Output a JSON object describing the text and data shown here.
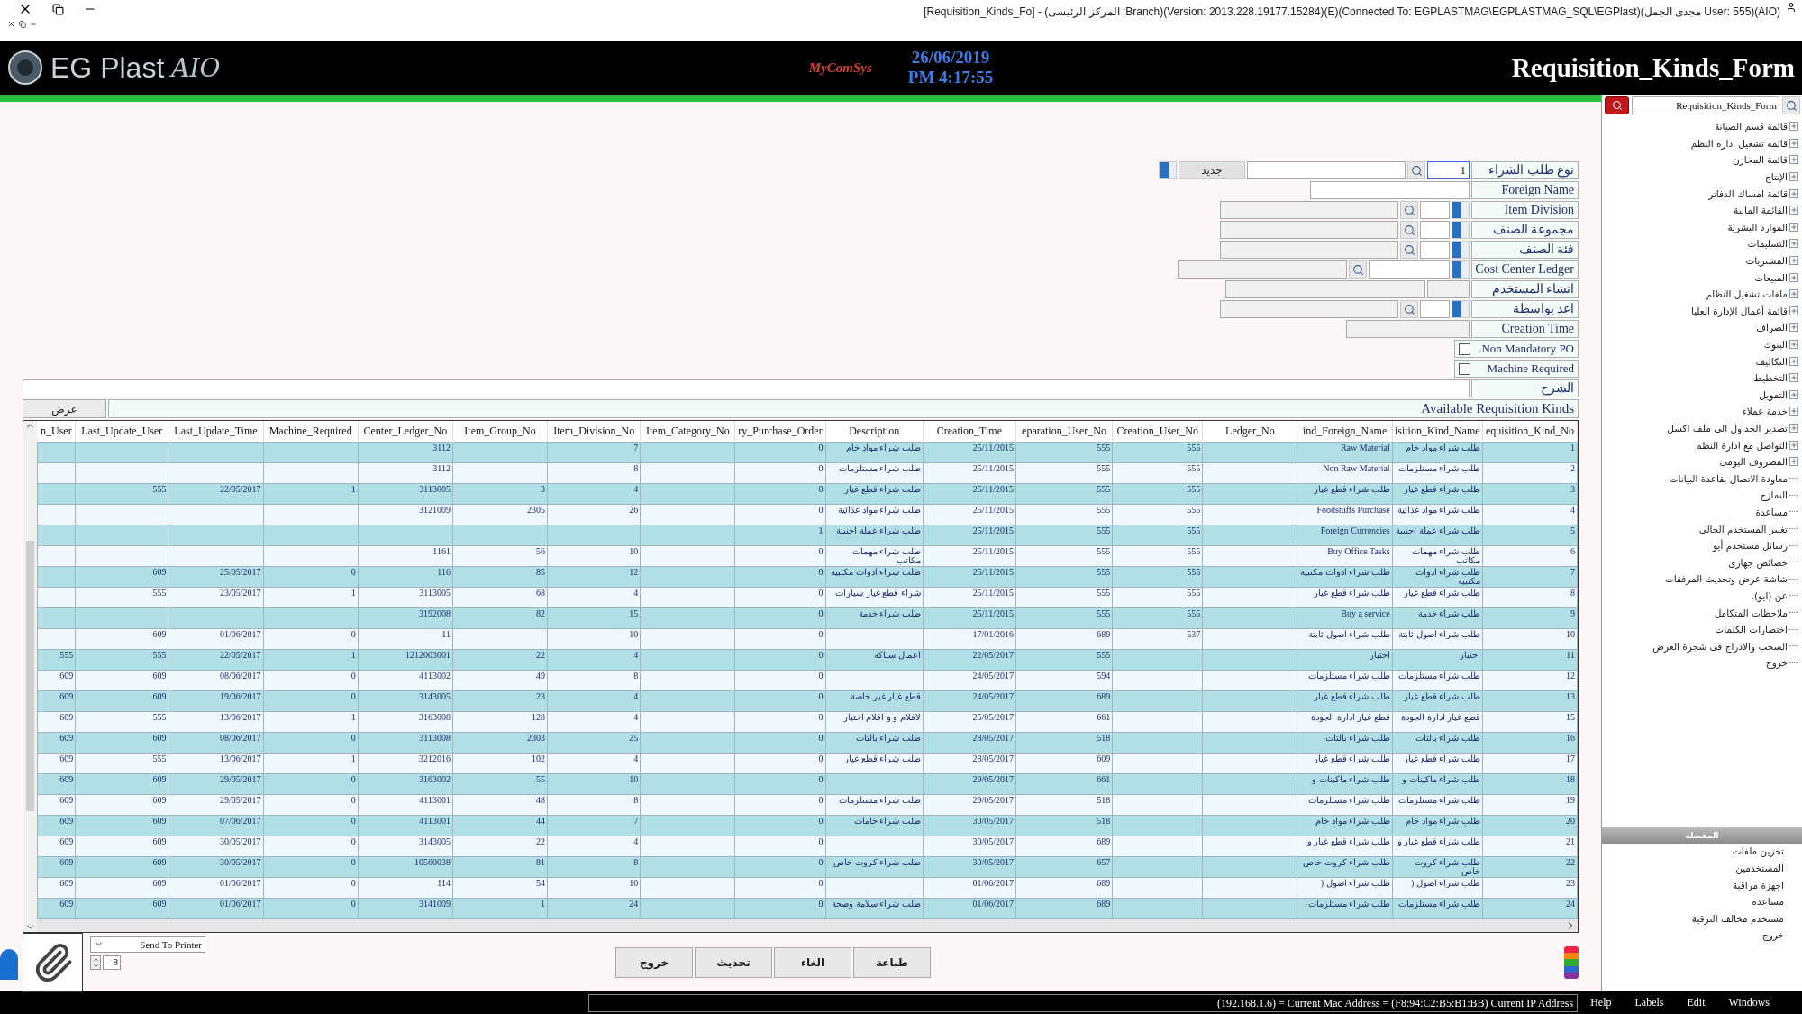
{
  "window": {
    "title": "[Requisition_Kinds_Fo] - (المركز الرئيسى :Branch)(Version: 2013.228.19177.15284)(E)(Connected To: EGPLASTMAG\\EGPLASTMAG_SQL\\EGPlast)(مجدى الجمل User: 555)(AIO)"
  },
  "header": {
    "logo": "EG Plast",
    "logo_script": "AIO",
    "vendor": "MyComSys",
    "date": "26/06/2019",
    "time": "PM 4:17:55",
    "form_title": "Requisition_Kinds_Form"
  },
  "form": {
    "fields": [
      {
        "kind": "code_lookup_new",
        "label": "نوع طلب الشراء",
        "value": "1",
        "new_button": "جديد"
      },
      {
        "kind": "text",
        "label": "Foreign Name"
      },
      {
        "kind": "lookup",
        "label": "Item Division"
      },
      {
        "kind": "lookup",
        "label": "مجموعة الصنف"
      },
      {
        "kind": "lookup",
        "label": "فئة الصنف"
      },
      {
        "kind": "lookup_wide",
        "label": "Cost Center Ledger"
      },
      {
        "kind": "readonly_pair",
        "label": "انشاء المستخدم"
      },
      {
        "kind": "lookup",
        "label": "اعد بواسطة"
      },
      {
        "kind": "readonly",
        "label": "Creation Time"
      },
      {
        "kind": "checkbox",
        "label": ".Non Mandatory PO",
        "checked": false
      },
      {
        "kind": "checkbox",
        "label": "Machine Required",
        "checked": false
      },
      {
        "kind": "memo",
        "label": "الشرح"
      }
    ]
  },
  "table": {
    "show_button": "عرض",
    "title": "Available Requisition Kinds",
    "columns": [
      "equisition_Kind_No",
      "isition_Kind_Name",
      "ind_Foreign_Name",
      "Ledger_No",
      "Creation_User_No",
      "eparation_User_No",
      "Creation_Time",
      "Description",
      "ry_Purchase_Order",
      "Item_Category_No",
      "Item_Division_No",
      "Item_Group_No",
      "Center_Ledger_No",
      "Machine_Required",
      "Last_Update_Time",
      "Last_Update_User",
      "n_User"
    ],
    "rows": [
      [
        "1",
        "طلب شراء مواد خام",
        "Raw Material",
        "",
        "555",
        "555",
        "25/11/2015",
        "طلب شراء مواد خام",
        "0",
        "",
        "7",
        "",
        "3112",
        "",
        "",
        "",
        ""
      ],
      [
        "2",
        "طلب شراء مستلزمات",
        "Non Raw Material",
        "",
        "555",
        "555",
        "25/11/2015",
        "طلب شراء مستلزمات",
        "0",
        "",
        "8",
        "",
        "3112",
        "",
        "",
        "",
        ""
      ],
      [
        "3",
        "طلب شراء قطع غيار",
        "طلب شراء قطع غيار",
        "",
        "555",
        "555",
        "25/11/2015",
        "طلب شراء قطع غيار",
        "0",
        "",
        "4",
        "3",
        "3113005",
        "1",
        "22/05/2017",
        "555",
        ""
      ],
      [
        "4",
        "طلب شراء مواد غذائية",
        "Foodstuffs Purchase",
        "",
        "555",
        "555",
        "25/11/2015",
        "طلب شراء مواد غذائية",
        "0",
        "",
        "26",
        "2305",
        "3121009",
        "",
        "",
        "",
        ""
      ],
      [
        "5",
        "طلب شراء عملة اجنبية",
        "Foreign Currencies",
        "",
        "555",
        "555",
        "25/11/2015",
        "طلب شراء عملة اجنبية",
        "1",
        "",
        "",
        "",
        "",
        "",
        "",
        "",
        ""
      ],
      [
        "6",
        "طلب شراء مهمات مكاتب",
        "Buy Office Tasks",
        "",
        "555",
        "555",
        "25/11/2015",
        "طلب شراء مهمات مكاتب",
        "0",
        "",
        "10",
        "56",
        "1161",
        "",
        "",
        "",
        ""
      ],
      [
        "7",
        "طلب شراء ادوات مكتبية",
        "طلب شراء ادوات مكتبية",
        "",
        "555",
        "555",
        "25/11/2015",
        "طلب شراء ادوات مكتبية",
        "0",
        "",
        "12",
        "85",
        "116",
        "0",
        "25/05/2017",
        "609",
        ""
      ],
      [
        "8",
        "طلب شراء قطع غيار",
        "طلب شراء قطع غيار",
        "",
        "555",
        "555",
        "25/11/2015",
        "شراء قطع غيار سيارات",
        "0",
        "",
        "4",
        "68",
        "3113005",
        "1",
        "23/05/2017",
        "555",
        ""
      ],
      [
        "9",
        "طلب شراء خدمة",
        "Buy a service",
        "",
        "555",
        "555",
        "25/11/2015",
        "طلب شراء خدمة",
        "0",
        "",
        "15",
        "82",
        "3192008",
        "",
        "",
        "",
        ""
      ],
      [
        "10",
        "طلب شراء اصول ثابتة",
        "طلب شراء اصول ثابتة",
        "",
        "537",
        "689",
        "17/01/2016",
        "",
        "0",
        "",
        "10",
        "",
        "11",
        "0",
        "01/06/2017",
        "609",
        ""
      ],
      [
        "11",
        "اختبار",
        "اختبار",
        "",
        "",
        "555",
        "22/05/2017",
        "اعمال سباكه",
        "0",
        "",
        "4",
        "22",
        "1212003001",
        "1",
        "22/05/2017",
        "555",
        "555"
      ],
      [
        "12",
        "طلب شراء مستلزمات",
        "طلب شراء مستلزمات",
        "",
        "",
        "594",
        "24/05/2017",
        "",
        "0",
        "",
        "8",
        "49",
        "4113002",
        "0",
        "08/06/2017",
        "609",
        "609"
      ],
      [
        "13",
        "طلب شراء قطع غيار",
        "طلب شراء قطع غيار",
        "",
        "",
        "689",
        "24/05/2017",
        "قطع غيار غير خاصة",
        "0",
        "",
        "4",
        "23",
        "3143005",
        "0",
        "19/06/2017",
        "609",
        "609"
      ],
      [
        "15",
        "قطع غيار ادارة الجودة",
        "قطع غيار ادارة الجودة",
        "",
        "",
        "661",
        "25/05/2017",
        "لافلام و و اقلام اختبار",
        "0",
        "",
        "4",
        "128",
        "3163008",
        "1",
        "13/06/2017",
        "555",
        "609"
      ],
      [
        "16",
        "طلب شراء بالتات",
        "طلب شراء بالتات",
        "",
        "",
        "518",
        "28/05/2017",
        "طلب شراء بالتات",
        "0",
        "",
        "25",
        "2303",
        "3113008",
        "0",
        "08/06/2017",
        "609",
        "609"
      ],
      [
        "17",
        "طلب شراء قطع غيار",
        "طلب شراء قطع غيار",
        "",
        "",
        "609",
        "28/05/2017",
        "طلب شراء قطع غيار",
        "0",
        "",
        "4",
        "102",
        "3212016",
        "1",
        "13/06/2017",
        "555",
        "609"
      ],
      [
        "18",
        "طلب شراء ماكينات و",
        "طلب شراء ماكينات و",
        "",
        "",
        "661",
        "29/05/2017",
        "",
        "0",
        "",
        "10",
        "55",
        "3163002",
        "0",
        "29/05/2017",
        "609",
        "609"
      ],
      [
        "19",
        "طلب شراء مستلزمات",
        "طلب شراء مستلزمات",
        "",
        "",
        "518",
        "29/05/2017",
        "طلب شراء مستلزمات",
        "0",
        "",
        "8",
        "48",
        "4113001",
        "0",
        "29/05/2017",
        "609",
        "609"
      ],
      [
        "20",
        "طلب شراء  مواد خام",
        "طلب شراء  مواد خام",
        "",
        "",
        "518",
        "30/05/2017",
        "طلب شراء خامات",
        "0",
        "",
        "7",
        "44",
        "4113001",
        "0",
        "07/06/2017",
        "609",
        "609"
      ],
      [
        "21",
        "طلب شراء قطع غيار و",
        "طلب شراء قطع غيار و",
        "",
        "",
        "689",
        "30/05/2017",
        "",
        "0",
        "",
        "4",
        "22",
        "3143005",
        "0",
        "30/05/2017",
        "609",
        "609"
      ],
      [
        "22",
        "طلب شراء كروت خاص",
        "طلب شراء كروت خاص",
        "",
        "",
        "657",
        "30/05/2017",
        "طلب شراء كروت خاص",
        "0",
        "",
        "8",
        "81",
        "10560038",
        "0",
        "30/05/2017",
        "609",
        "609"
      ],
      [
        "23",
        "طلب شراء اصول (",
        "طلب شراء اصول (",
        "",
        "",
        "689",
        "01/06/2017",
        "",
        "0",
        "",
        "10",
        "54",
        "114",
        "0",
        "01/06/2017",
        "609",
        "609"
      ],
      [
        "24",
        "طلب شراء  مستلزمات",
        "طلب شراء  مستلزمات",
        "",
        "",
        "689",
        "01/06/2017",
        "طلب شراء  سلامة وصحة",
        "0",
        "",
        "24",
        "1",
        "3141009",
        "0",
        "01/06/2017",
        "609",
        "609"
      ]
    ]
  },
  "print": {
    "target": "Send To Printer",
    "copies": "8"
  },
  "buttons": [
    "طباعة",
    "الغاء",
    "تحديث",
    "خروج"
  ],
  "sidebar": {
    "search": "Requisition_Kinds_Form",
    "items": [
      {
        "label": "قائمة قسم الصيانة",
        "kind": "group"
      },
      {
        "label": "قائمة تشغيل ادارة النظم",
        "kind": "group"
      },
      {
        "label": "قائمة المخازن",
        "kind": "group"
      },
      {
        "label": "الإنتاج",
        "kind": "group"
      },
      {
        "label": "قائمة امساك الدفاتر",
        "kind": "group"
      },
      {
        "label": "القائمة المالية",
        "kind": "group"
      },
      {
        "label": "الموارد البشرية",
        "kind": "group"
      },
      {
        "label": "التسليمات",
        "kind": "group"
      },
      {
        "label": "المشتريات",
        "kind": "group"
      },
      {
        "label": "المبيعات",
        "kind": "group"
      },
      {
        "label": "ملفات تشغيل النظام",
        "kind": "group"
      },
      {
        "label": "قائمة أعمال الإدارة العليا",
        "kind": "group"
      },
      {
        "label": "الصراف",
        "kind": "group"
      },
      {
        "label": "البنوك",
        "kind": "group"
      },
      {
        "label": "التكاليف",
        "kind": "group"
      },
      {
        "label": "التخطيط",
        "kind": "group"
      },
      {
        "label": "التمويل",
        "kind": "group"
      },
      {
        "label": "خدمة عملاء",
        "kind": "group"
      },
      {
        "label": "تصدير الجداول الى ملف اكسل",
        "kind": "group"
      },
      {
        "label": "التواصل مع ادارة النظم",
        "kind": "group"
      },
      {
        "label": "المصروف اليومى",
        "kind": "group"
      },
      {
        "label": "معاودة الاتصال بقاعدة البيانات",
        "kind": "leaf"
      },
      {
        "label": "النمازج",
        "kind": "leaf"
      },
      {
        "label": "مساعدة",
        "kind": "leaf"
      },
      {
        "label": "تغيير المستخدم الحالى",
        "kind": "leaf"
      },
      {
        "label": "رسائل مستخدم أيو",
        "kind": "leaf"
      },
      {
        "label": "خصائص جهازى",
        "kind": "leaf"
      },
      {
        "label": "شاشة عرض وتحديث المرفقات",
        "kind": "leaf"
      },
      {
        "label": "عن (ايو).",
        "kind": "leaf"
      },
      {
        "label": "ملاحظات المتكامل",
        "kind": "leaf"
      },
      {
        "label": "اختصارات الكلمات",
        "kind": "leaf"
      },
      {
        "label": "السحب والادراج فى شجرة العرض",
        "kind": "leaf"
      },
      {
        "label": "خروج",
        "kind": "leaf"
      }
    ],
    "favorites_title": "المفضلة",
    "favorites": [
      "تخزين ملفات",
      "المستخدمين",
      "اجهزة مراقبة",
      "مساعدة",
      "مستخدم مخالف الترقية",
      "خروج"
    ]
  },
  "status_bar": {
    "text": "(192.168.1.6) = Current Mac Address = (F8:94:C2:B5:B1:BB) Current IP Address",
    "menu": [
      "Windows",
      "Edit",
      "Labels",
      "Help"
    ]
  }
}
